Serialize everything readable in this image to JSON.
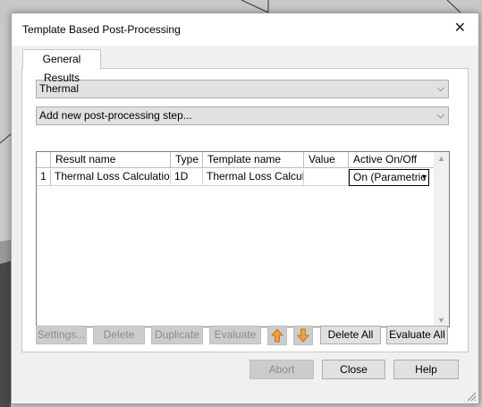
{
  "dialog": {
    "title": "Template Based Post-Processing",
    "close_glyph": "✕",
    "tab_label": "General Results",
    "category_value": "Thermal",
    "step_value": "Add new post-processing step...",
    "dropdown_glyph": "⌵"
  },
  "table": {
    "columns": [
      "Result name",
      "Type",
      "Template name",
      "Value",
      "Active On/Off"
    ],
    "rows": [
      {
        "index": "1",
        "result_name": "Thermal Loss Calculation",
        "type": "1D",
        "template_name": "Thermal Loss Calculation",
        "value": "",
        "active": "On (Parametric"
      }
    ],
    "scroll_up": "▲",
    "scroll_down": "▼",
    "cell_dropdown_glyph": "▾"
  },
  "buttons": {
    "settings": "Settings...",
    "delete": "Delete",
    "duplicate": "Duplicate",
    "evaluate": "Evaluate",
    "move_up_icon": "arrow-up-icon",
    "move_down_icon": "arrow-down-icon",
    "delete_all": "Delete All",
    "evaluate_all": "Evaluate All",
    "abort": "Abort",
    "close": "Close",
    "help": "Help"
  },
  "colors": {
    "arrow_orange": "#f0a040",
    "disabled_text": "#8a8a8a",
    "selected_cell_border": "#000000"
  }
}
